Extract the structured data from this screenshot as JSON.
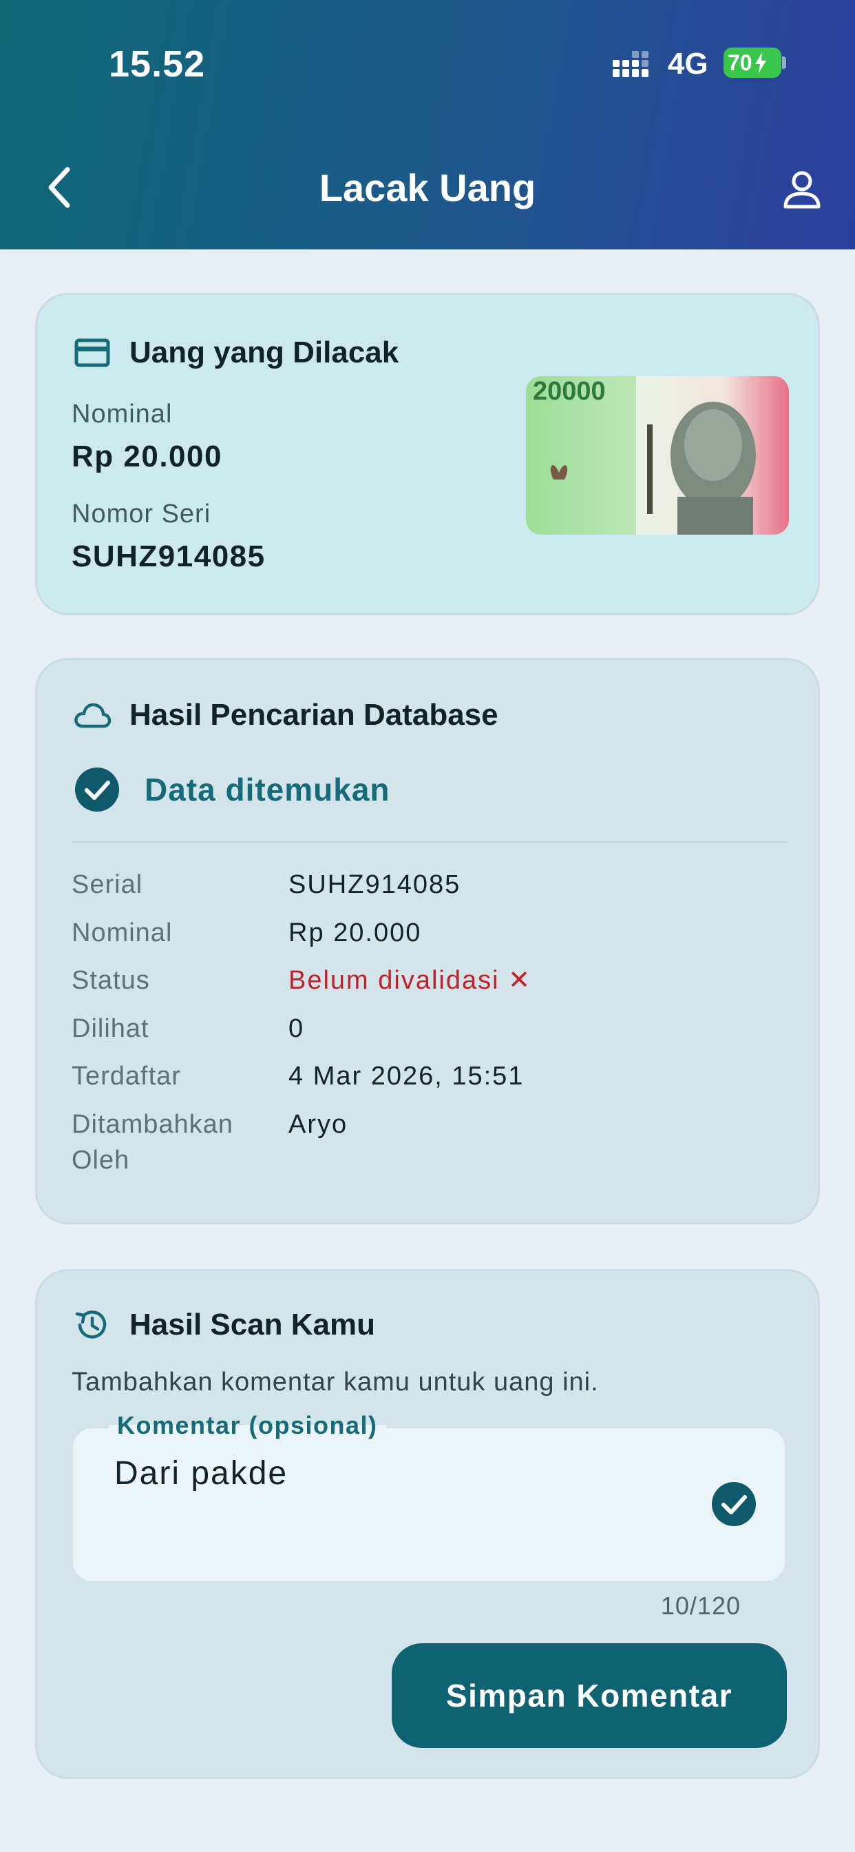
{
  "status_bar": {
    "time": "15.52",
    "network": "4G",
    "battery": "70"
  },
  "header": {
    "title": "Lacak Uang",
    "back_icon": "chevron-left-icon",
    "profile_icon": "user-icon"
  },
  "tracked_money": {
    "heading": "Uang yang Dilacak",
    "icon": "card-icon",
    "nominal_label": "Nominal",
    "nominal_value": "Rp 20.000",
    "serial_label": "Nomor Seri",
    "serial_value": "SUHZ914085",
    "banknote_text": "20000"
  },
  "database_result": {
    "heading": "Hasil Pencarian Database",
    "icon": "cloud-icon",
    "found_text": "Data ditemukan",
    "rows": [
      {
        "label": "Serial",
        "value": "SUHZ914085"
      },
      {
        "label": "Nominal",
        "value": "Rp 20.000"
      },
      {
        "label": "Status",
        "value": "Belum divalidasi ✕"
      },
      {
        "label": "Dilihat",
        "value": "0"
      },
      {
        "label": "Terdaftar",
        "value": "4 Mar 2026, 15:51"
      },
      {
        "label": "Ditambahkan Oleh",
        "value": "Aryo"
      }
    ],
    "status_color": "#c0202a"
  },
  "scan_result": {
    "heading": "Hasil Scan Kamu",
    "icon": "history-icon",
    "subtitle": "Tambahkan komentar kamu untuk uang ini.",
    "comment_label": "Komentar (opsional)",
    "comment_value": "Dari pakde",
    "counter": "10/120",
    "save_label": "Simpan Komentar"
  },
  "colors": {
    "accent": "#0e6272",
    "header_start": "#0f6977",
    "header_end": "#2d3f9e"
  }
}
